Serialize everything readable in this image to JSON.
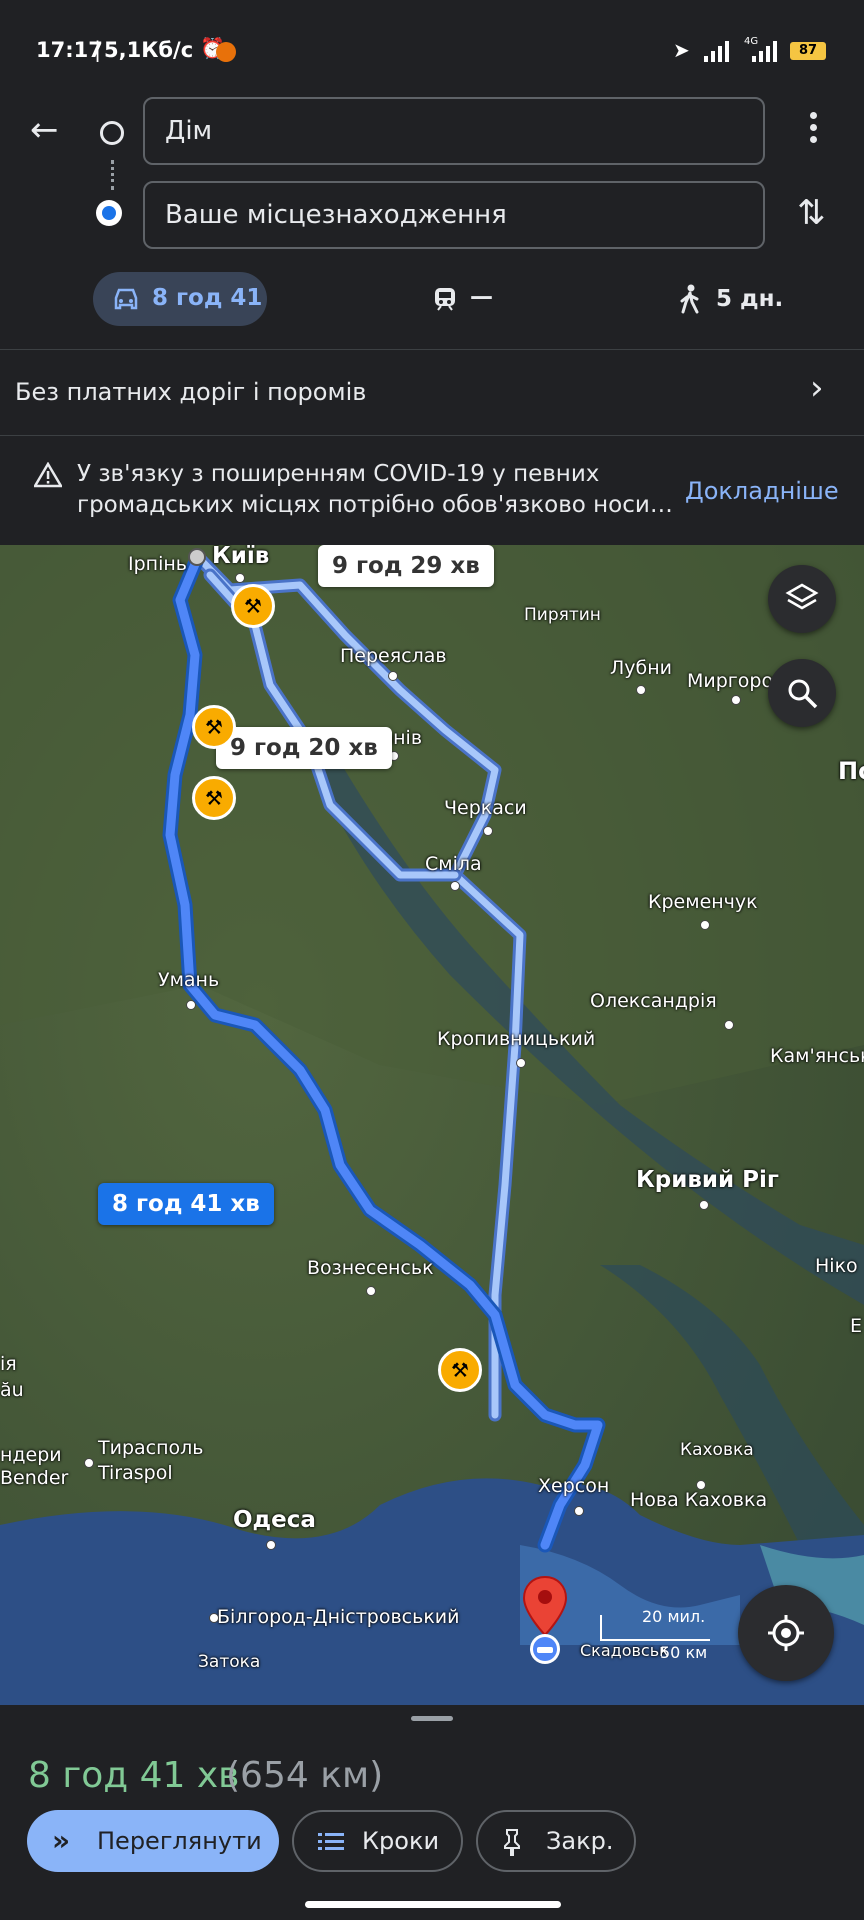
{
  "status_bar": {
    "time": "17:17",
    "separator": "|",
    "speed": "5,1Кб/с",
    "network": "4G",
    "battery": "87"
  },
  "directions": {
    "origin": "Дім",
    "destination": "Ваше місцезнаходження"
  },
  "modes": [
    {
      "icon": "car-icon",
      "label": "8 год 41",
      "selected": true
    },
    {
      "icon": "train-icon",
      "label": "—",
      "selected": false
    },
    {
      "icon": "walk-icon",
      "label": "5 дн.",
      "selected": false
    }
  ],
  "options_row": {
    "label": "Без платних доріг і поромів"
  },
  "covid_notice": {
    "line1": "У зв'язку з поширенням COVID-19 у певних",
    "line2": "громадських місцях потрібно обов'язково носи…",
    "link": "Докладніше"
  },
  "map": {
    "route_labels": {
      "alt1": "9 год 29 хв",
      "alt2": "9 год 20 хв",
      "primary": "8 год 41 хв"
    },
    "cities": {
      "kyiv": "Київ",
      "irpin": "Ірпінь",
      "pyriatyn": "Пирятин",
      "pereiaslav": "Переяслав",
      "lubny": "Лубни",
      "myrhorod": "Миргород",
      "kaniv": "Канів",
      "cherkasy": "Черкаси",
      "smila": "Сміла",
      "kremenchuk": "Кременчук",
      "uman": "Умань",
      "oleksandriia": "Олександрія",
      "kropyvnytskyi": "Кропивницький",
      "kamianske": "Кам'янськ",
      "kryvyi_rih": "Кривий Ріг",
      "voznesensk": "Вознесенськ",
      "nikopol": "Ніко",
      "tiraspol_ua": "Тирасполь",
      "tiraspol": "Tiraspol",
      "bendery_ua": "ндери",
      "bendery": "Bender",
      "odesa": "Одеса",
      "kherson": "Херсон",
      "kakhovka": "Каховка",
      "nova_kakhovka": "Нова Каховка",
      "bilhorod": "Білгород-Дністровський",
      "zatoka": "Затока",
      "skadovsk": "Скадовськ",
      "edge_po": "По",
      "edge_e": "Е",
      "edge_ia": "ія",
      "edge_au": "ău"
    },
    "scale": {
      "miles": "20 мил.",
      "km": "50 км"
    }
  },
  "summary": {
    "duration": "8 год 41 хв",
    "distance": "(654 км)"
  },
  "actions": {
    "preview": "Переглянути",
    "steps": "Кроки",
    "pin": "Закр."
  }
}
